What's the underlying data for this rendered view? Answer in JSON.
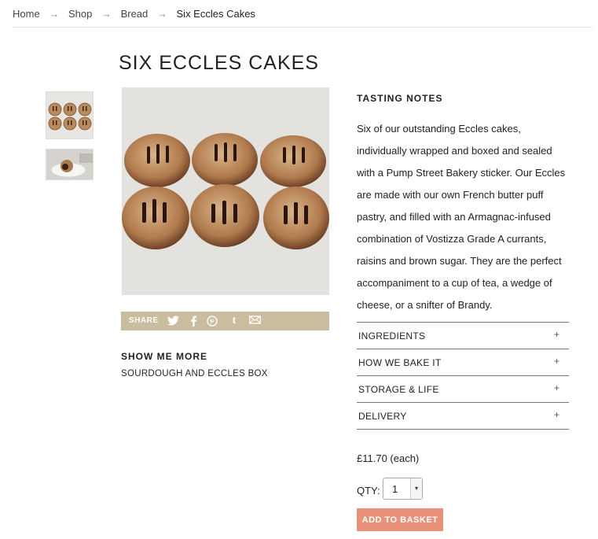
{
  "breadcrumb": {
    "items": [
      "Home",
      "Shop",
      "Bread",
      "Six Eccles Cakes"
    ],
    "separator": "→"
  },
  "product": {
    "title": "SIX ECCLES CAKES",
    "image_alt": "Six Eccles cakes on a grey cloth",
    "thumbnails": [
      "six-cakes-thumbnail",
      "plated-cake-thumbnail"
    ]
  },
  "share": {
    "label": "SHARE",
    "icons": [
      "twitter-icon",
      "facebook-icon",
      "pinterest-icon",
      "tumblr-icon",
      "email-icon"
    ],
    "bar_color": "#c9bc9f"
  },
  "show_more": {
    "title": "SHOW ME MORE",
    "link": "SOURDOUGH AND ECCLES BOX"
  },
  "tasting_notes": {
    "title": "TASTING NOTES",
    "body": "Six of our outstanding Eccles cakes, individually wrapped and boxed and sealed with a Pump Street Bakery sticker. Our Eccles are made with our own French butter puff pastry, and filled with an Armagnac-infused combination of Vostizza Grade A currants, raisins and brown sugar. They are the perfect accompaniment to a cup of tea, a wedge of cheese, or a snifter of Brandy."
  },
  "accordion": [
    {
      "label": "INGREDIENTS",
      "icon": "+"
    },
    {
      "label": "HOW WE BAKE IT",
      "icon": "+"
    },
    {
      "label": "STORAGE & LIFE",
      "icon": "+"
    },
    {
      "label": "DELIVERY",
      "icon": "+"
    }
  ],
  "purchase": {
    "price": "£11.70 (each)",
    "qty_label": "QTY:",
    "qty_value": "1",
    "qty_arrow": "▾",
    "add_to_basket": "ADD TO BASKET",
    "button_color": "#e8917b"
  }
}
